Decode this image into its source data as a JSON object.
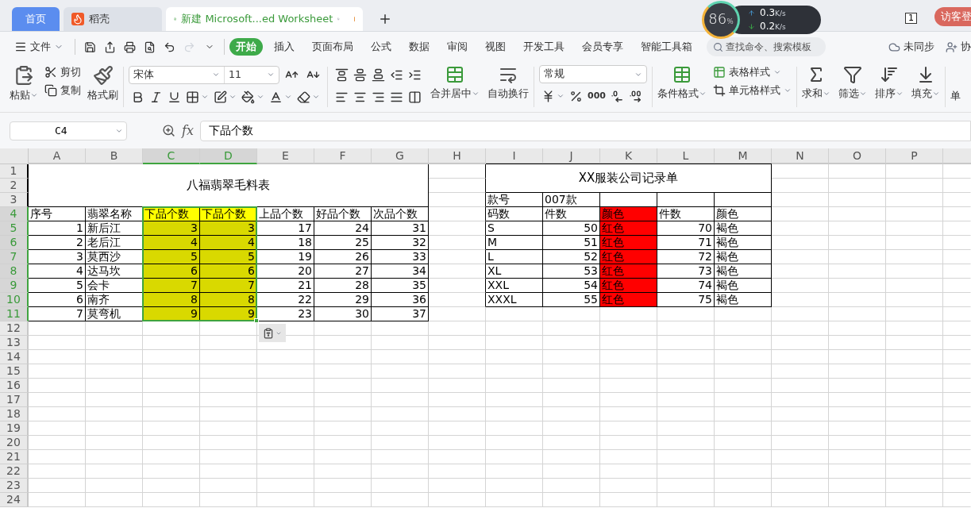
{
  "tabs": [
    {
      "label": "首页",
      "kind": "home",
      "selected": false
    },
    {
      "label": "稻壳",
      "kind": "app",
      "selected": false
    },
    {
      "label": "新建 Microsoft...ed Worksheet",
      "kind": "document",
      "selected": true
    }
  ],
  "monitor": {
    "cpu": "86",
    "cpu_unit": "%",
    "upload": "0.3",
    "upload_unit": "K/s",
    "download": "0.2",
    "download_unit": "K/s"
  },
  "window_count": "1",
  "login_button": "访客登",
  "menu": {
    "file": "文件",
    "ribbon_tabs": [
      {
        "label": "开始",
        "selected": true
      },
      {
        "label": "插入",
        "selected": false
      },
      {
        "label": "页面布局",
        "selected": false
      },
      {
        "label": "公式",
        "selected": false
      },
      {
        "label": "数据",
        "selected": false
      },
      {
        "label": "审阅",
        "selected": false
      },
      {
        "label": "视图",
        "selected": false
      },
      {
        "label": "开发工具",
        "selected": false
      },
      {
        "label": "会员专享",
        "selected": false
      },
      {
        "label": "智能工具箱",
        "selected": false
      }
    ],
    "search": {
      "placeholder": "查找命令、搜索模板"
    },
    "sync": "未同步",
    "collab": "协"
  },
  "toolbar": {
    "paste": "粘贴",
    "cut": "剪切",
    "copy": "复制",
    "format_painter": "格式刷",
    "font": "宋体",
    "font_size": "11",
    "merge": "合并居中",
    "wrap": "自动换行",
    "number_format": "常规",
    "thousands": "000",
    "conditional_format": "条件格式",
    "table_style": "表格样式",
    "cell_style": "单元格样式",
    "sum": "求和",
    "filter": "筛选",
    "sort": "排序",
    "fill": "填充",
    "cut_off": "单"
  },
  "name_box": "C4",
  "fx": "fx",
  "formula": "下品个数",
  "sheet": {
    "columns": [
      {
        "label": "A",
        "selected": false
      },
      {
        "label": "B",
        "selected": false
      },
      {
        "label": "C",
        "selected": true
      },
      {
        "label": "D",
        "selected": true
      },
      {
        "label": "E",
        "selected": false
      },
      {
        "label": "F",
        "selected": false
      },
      {
        "label": "G",
        "selected": false
      },
      {
        "label": "H",
        "selected": false
      },
      {
        "label": "I",
        "selected": false
      },
      {
        "label": "J",
        "selected": false
      },
      {
        "label": "K",
        "selected": false
      },
      {
        "label": "L",
        "selected": false
      },
      {
        "label": "M",
        "selected": false
      },
      {
        "label": "N",
        "selected": false
      },
      {
        "label": "O",
        "selected": false
      },
      {
        "label": "P",
        "selected": false
      }
    ],
    "rows": [
      {
        "label": "1",
        "selected": false
      },
      {
        "label": "2",
        "selected": false
      },
      {
        "label": "3",
        "selected": false
      },
      {
        "label": "4",
        "selected": true
      },
      {
        "label": "5",
        "selected": true
      },
      {
        "label": "6",
        "selected": true
      },
      {
        "label": "7",
        "selected": true
      },
      {
        "label": "8",
        "selected": true
      },
      {
        "label": "9",
        "selected": true
      },
      {
        "label": "10",
        "selected": true
      },
      {
        "label": "11",
        "selected": true
      },
      {
        "label": "12",
        "selected": false
      },
      {
        "label": "13",
        "selected": false
      },
      {
        "label": "14",
        "selected": false
      },
      {
        "label": "15",
        "selected": false
      },
      {
        "label": "16",
        "selected": false
      },
      {
        "label": "17",
        "selected": false
      },
      {
        "label": "18",
        "selected": false
      },
      {
        "label": "19",
        "selected": false
      },
      {
        "label": "20",
        "selected": false
      },
      {
        "label": "21",
        "selected": false
      },
      {
        "label": "22",
        "selected": false
      },
      {
        "label": "23",
        "selected": false
      },
      {
        "label": "24",
        "selected": false
      }
    ]
  },
  "table1": {
    "title": "八福翡翠毛料表",
    "header": [
      {
        "text": "序号",
        "numeric": true
      },
      {
        "text": "翡翠名称",
        "numeric": false
      },
      {
        "text": "下品个数",
        "numeric": true,
        "color": "#ffff00"
      },
      {
        "text": "下品个数",
        "numeric": true,
        "color": "#ffff00"
      },
      {
        "text": "上品个数",
        "numeric": true
      },
      {
        "text": "好品个数",
        "numeric": true
      },
      {
        "text": "次品个数",
        "numeric": true
      }
    ],
    "rows": [
      [
        "1",
        "新后江",
        "3",
        "3",
        "17",
        "24",
        "31"
      ],
      [
        "2",
        "老后江",
        "4",
        "4",
        "18",
        "25",
        "32"
      ],
      [
        "3",
        "莫西沙",
        "5",
        "5",
        "19",
        "26",
        "33"
      ],
      [
        "4",
        "达马坎",
        "6",
        "6",
        "20",
        "27",
        "34"
      ],
      [
        "5",
        "会卡",
        "7",
        "7",
        "21",
        "28",
        "35"
      ],
      [
        "6",
        "南齐",
        "8",
        "8",
        "22",
        "29",
        "36"
      ],
      [
        "7",
        "莫弯机",
        "9",
        "9",
        "23",
        "30",
        "37"
      ]
    ]
  },
  "table2": {
    "title": "XX服装公司记录单",
    "info": [
      "款号",
      "007款"
    ],
    "header": [
      {
        "text": "码数",
        "numeric": false
      },
      {
        "text": "件数",
        "numeric": true
      },
      {
        "text": "颜色",
        "numeric": false,
        "color": "#ff0000"
      },
      {
        "text": "件数",
        "numeric": true
      },
      {
        "text": "颜色",
        "numeric": false
      }
    ],
    "rows": [
      [
        "S",
        "50",
        "红色",
        "70",
        "褐色"
      ],
      [
        "M",
        "51",
        "红色",
        "71",
        "褐色"
      ],
      [
        "L",
        "52",
        "红色",
        "72",
        "褐色"
      ],
      [
        "XL",
        "53",
        "红色",
        "73",
        "褐色"
      ],
      [
        "XXL",
        "54",
        "红色",
        "74",
        "褐色"
      ],
      [
        "XXXL",
        "55",
        "红色",
        "75",
        "褐色"
      ]
    ]
  }
}
